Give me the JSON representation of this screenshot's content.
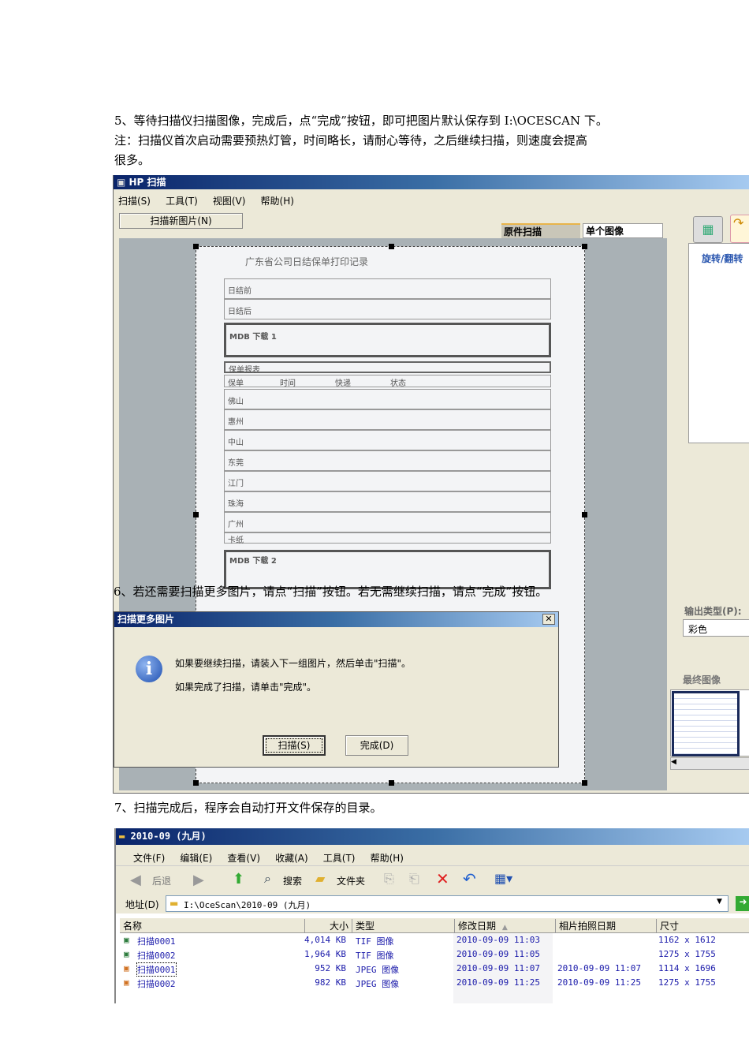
{
  "paragraphs": {
    "p5_line1": "5、等待扫描仪扫描图像，完成后，点“完成”按钮，即可把图片默认保存到 I:\\OCESCAN 下。",
    "p5_line2": "注：扫描仪首次启动需要预热灯管，时间略长，请耐心等待，之后继续扫描，则速度会提高",
    "p5_line3": "很多。",
    "p6": "6、若还需要扫描更多图片，请点“扫描”按钮。若无需继续扫描，请点“完成”按钮。",
    "p7": "7、扫描完成后，程序会自动打开文件保存的目录。"
  },
  "scanner": {
    "title": "HP 扫描",
    "menu": [
      "扫描(S)",
      "工具(T)",
      "视图(V)",
      "帮助(H)"
    ],
    "scan_new_button": "扫描新图片(N)",
    "tabs": [
      "原件扫描",
      "单个图像"
    ],
    "panel_title": "旋转/翻转",
    "output_type_label": "输出类型(P):",
    "output_type_value": "彩色",
    "final_image_label": "最终图像",
    "document": {
      "title": "广东省公司日结保单打印记录",
      "section1": [
        "日结前",
        "日结后"
      ],
      "mdb1": "MDB 下载 1",
      "report": "保单报表",
      "columns": [
        "保单",
        "时间",
        "快递",
        "状态"
      ],
      "cities": [
        "佛山",
        "惠州",
        "中山",
        "东莞",
        "江门",
        "珠海",
        "广州",
        "卡纸"
      ],
      "mdb2": "MDB 下载 2"
    }
  },
  "dialog": {
    "title": "扫描更多图片",
    "line1": "如果要继续扫描，请装入下一组图片，然后单击\"扫描\"。",
    "line2": "如果完成了扫描，请单击\"完成\"。",
    "scan_button": "扫描(S)",
    "done_button": "完成(D)"
  },
  "explorer": {
    "title": "2010-09 (九月)",
    "menu": [
      "文件(F)",
      "编辑(E)",
      "查看(V)",
      "收藏(A)",
      "工具(T)",
      "帮助(H)"
    ],
    "toolbar": {
      "back": "后退",
      "search": "搜索",
      "folders": "文件夹"
    },
    "address_label": "地址(D)",
    "address_value": "I:\\OceScan\\2010-09 (九月)",
    "columns": [
      "名称",
      "大小",
      "类型",
      "修改日期",
      "相片拍照日期",
      "尺寸"
    ],
    "files": [
      {
        "name": "扫描0001",
        "size": "4,014 KB",
        "type": "TIF 图像",
        "modified": "2010-09-09 11:03",
        "taken": "",
        "dims": "1162 x 1612",
        "kind": "tif"
      },
      {
        "name": "扫描0002",
        "size": "1,964 KB",
        "type": "TIF 图像",
        "modified": "2010-09-09 11:05",
        "taken": "",
        "dims": "1275 x 1755",
        "kind": "tif"
      },
      {
        "name": "扫描0001",
        "size": "952 KB",
        "type": "JPEG 图像",
        "modified": "2010-09-09 11:07",
        "taken": "2010-09-09 11:07",
        "dims": "1114 x 1696",
        "kind": "jpg"
      },
      {
        "name": "扫描0002",
        "size": "982 KB",
        "type": "JPEG 图像",
        "modified": "2010-09-09 11:25",
        "taken": "2010-09-09 11:25",
        "dims": "1275 x 1755",
        "kind": "jpg"
      }
    ]
  }
}
